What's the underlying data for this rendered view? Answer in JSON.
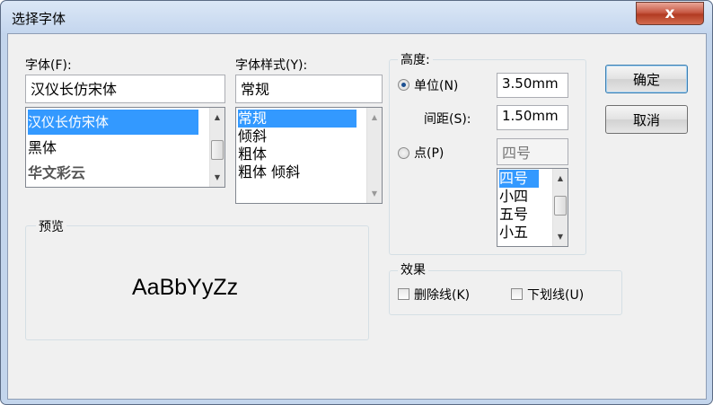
{
  "window": {
    "title": "选择字体",
    "close_glyph": "x"
  },
  "font": {
    "label": "字体(F):",
    "value": "汉仪长仿宋体",
    "items": [
      "汉仪长仿宋体",
      "黑体",
      "华文彩云"
    ],
    "selected_index": 0
  },
  "style": {
    "label": "字体样式(Y):",
    "value": "常规",
    "items": [
      "常规",
      "倾斜",
      "粗体",
      "粗体 倾斜"
    ],
    "selected_index": 0
  },
  "height": {
    "group_label": "高度:",
    "unit_label": "单位(N)",
    "unit_value": "3.50mm",
    "spacing_label": "间距(S):",
    "spacing_value": "1.50mm",
    "point_label": "点(P)",
    "point_value": "四号",
    "point_items": [
      "四号",
      "小四",
      "五号",
      "小五"
    ],
    "point_selected_index": 0
  },
  "buttons": {
    "ok": "确定",
    "cancel": "取消"
  },
  "preview": {
    "group_label": "预览",
    "sample": "AaBbYyZz"
  },
  "effects": {
    "group_label": "效果",
    "strikethrough_label": "删除线(K)",
    "underline_label": "下划线(U)",
    "strikethrough_checked": false,
    "underline_checked": false
  },
  "colors": {
    "selection": "#3399ff",
    "background": "#f0f0f0",
    "close_button": "#c85a45"
  }
}
